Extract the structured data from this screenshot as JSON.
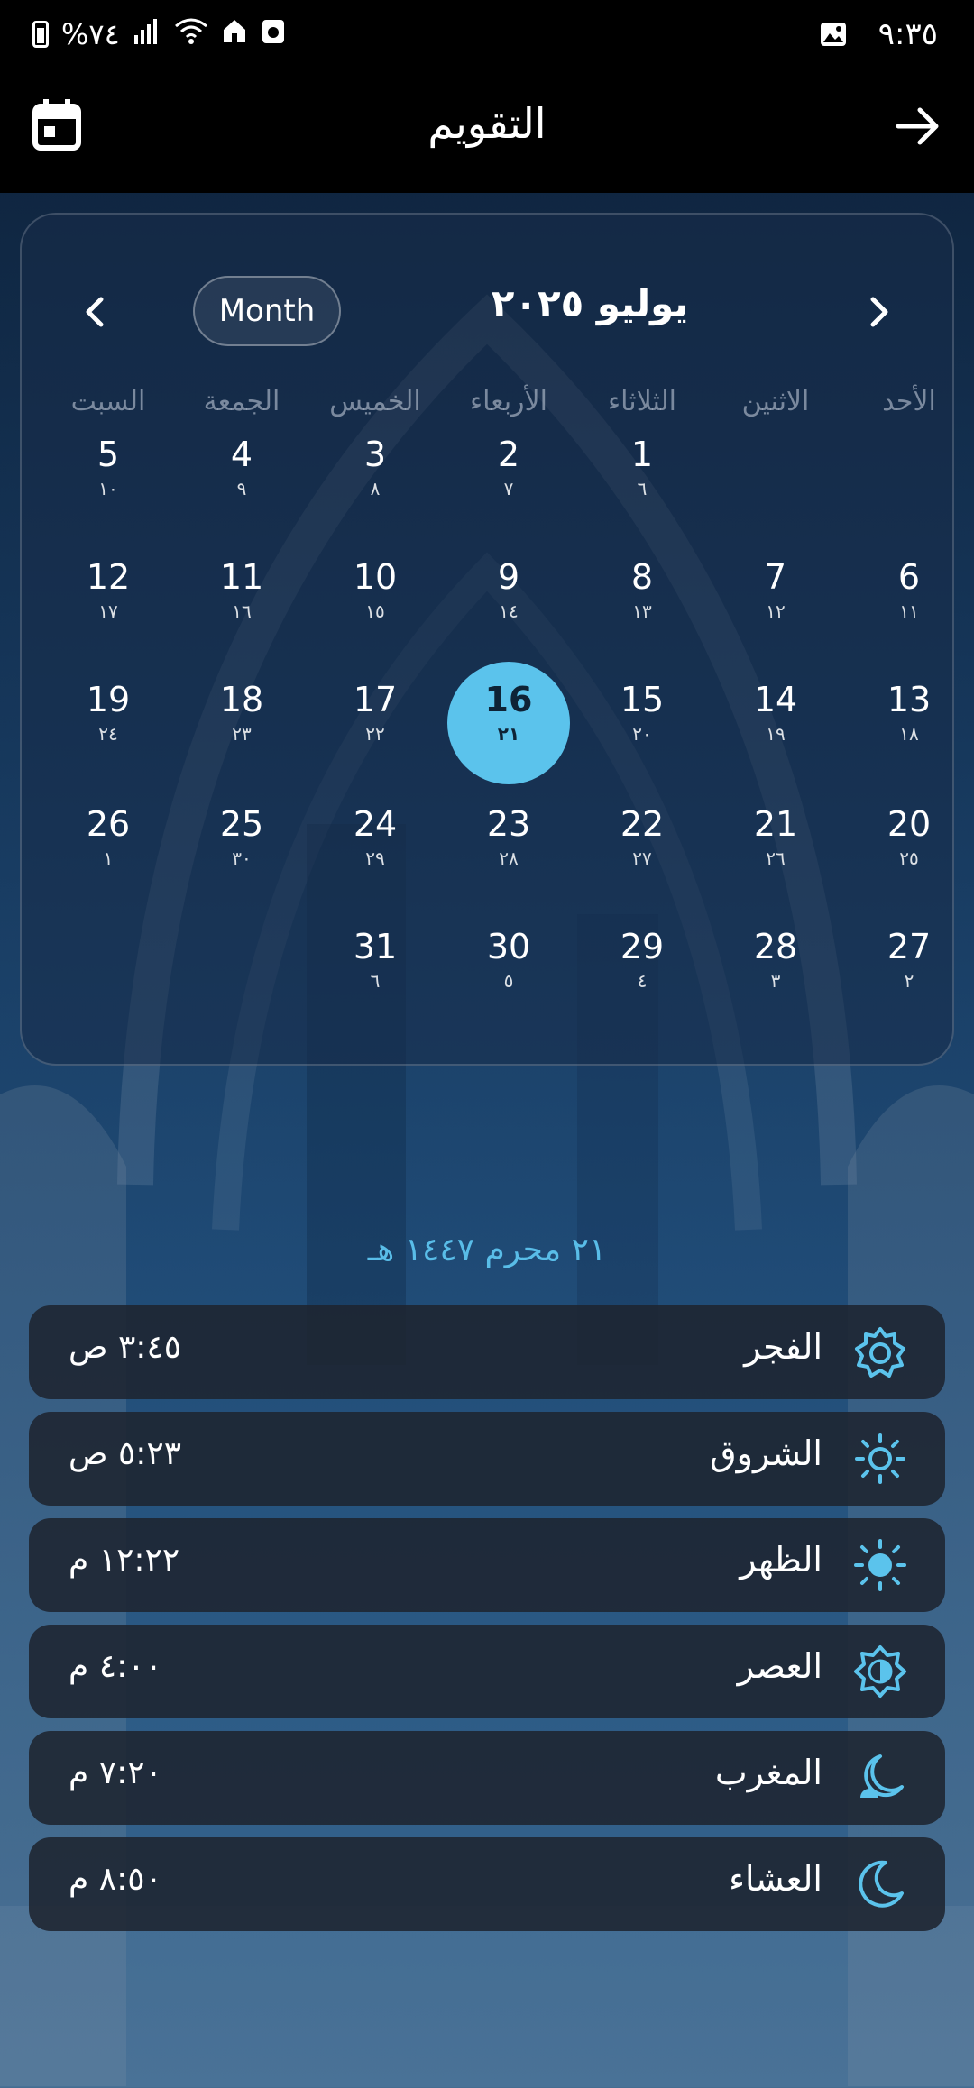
{
  "status_bar": {
    "time": "٩:٣٥",
    "battery_text": "%٧٤",
    "icons": [
      "battery-icon",
      "signal-icon",
      "wifi-icon",
      "home-icon",
      "recycle-icon",
      "gallery-icon"
    ]
  },
  "app_bar": {
    "title": "التقويم",
    "left_icon": "calendar-icon",
    "right_icon": "arrow-right-icon"
  },
  "calendar": {
    "view_button": "Month",
    "month_title": "يوليو ٢٠٢٥",
    "weekdays": [
      "السبت",
      "الجمعة",
      "الخميس",
      "الأربعاء",
      "الثلاثاء",
      "الاثنين",
      "الأحد"
    ],
    "weeks": [
      [
        {
          "g": "5",
          "h": "١٠"
        },
        {
          "g": "4",
          "h": "٩"
        },
        {
          "g": "3",
          "h": "٨"
        },
        {
          "g": "2",
          "h": "٧"
        },
        {
          "g": "1",
          "h": "٦"
        },
        null,
        null
      ],
      [
        {
          "g": "12",
          "h": "١٧"
        },
        {
          "g": "11",
          "h": "١٦"
        },
        {
          "g": "10",
          "h": "١٥"
        },
        {
          "g": "9",
          "h": "١٤"
        },
        {
          "g": "8",
          "h": "١٣"
        },
        {
          "g": "7",
          "h": "١٢"
        },
        {
          "g": "6",
          "h": "١١"
        }
      ],
      [
        {
          "g": "19",
          "h": "٢٤"
        },
        {
          "g": "18",
          "h": "٢٣"
        },
        {
          "g": "17",
          "h": "٢٢"
        },
        {
          "g": "16",
          "h": "٢١",
          "today": true
        },
        {
          "g": "15",
          "h": "٢٠"
        },
        {
          "g": "14",
          "h": "١٩"
        },
        {
          "g": "13",
          "h": "١٨"
        }
      ],
      [
        {
          "g": "26",
          "h": "١"
        },
        {
          "g": "25",
          "h": "٣٠"
        },
        {
          "g": "24",
          "h": "٢٩"
        },
        {
          "g": "23",
          "h": "٢٨"
        },
        {
          "g": "22",
          "h": "٢٧"
        },
        {
          "g": "21",
          "h": "٢٦"
        },
        {
          "g": "20",
          "h": "٢٥"
        }
      ],
      [
        null,
        null,
        {
          "g": "31",
          "h": "٦"
        },
        {
          "g": "30",
          "h": "٥"
        },
        {
          "g": "29",
          "h": "٤"
        },
        {
          "g": "28",
          "h": "٣"
        },
        {
          "g": "27",
          "h": "٢"
        }
      ]
    ]
  },
  "hijri_date": "٢١ محرم ١٤٤٧ هـ",
  "prayers": [
    {
      "name": "الفجر",
      "time": "٣:٤٥ ص",
      "icon": "sun-gear-icon"
    },
    {
      "name": "الشروق",
      "time": "٥:٢٣ ص",
      "icon": "sun-outline-icon"
    },
    {
      "name": "الظهر",
      "time": "١٢:٢٢ م",
      "icon": "sun-filled-icon"
    },
    {
      "name": "العصر",
      "time": "٤:٠٠ م",
      "icon": "half-sun-icon"
    },
    {
      "name": "المغرب",
      "time": "٧:٢٠ م",
      "icon": "moon-set-icon"
    },
    {
      "name": "العشاء",
      "time": "٨:٥٠ م",
      "icon": "crescent-moon-icon"
    }
  ],
  "colors": {
    "accent": "#5bc3ec",
    "bar": "#000000",
    "row_bg": "#1e2430"
  }
}
